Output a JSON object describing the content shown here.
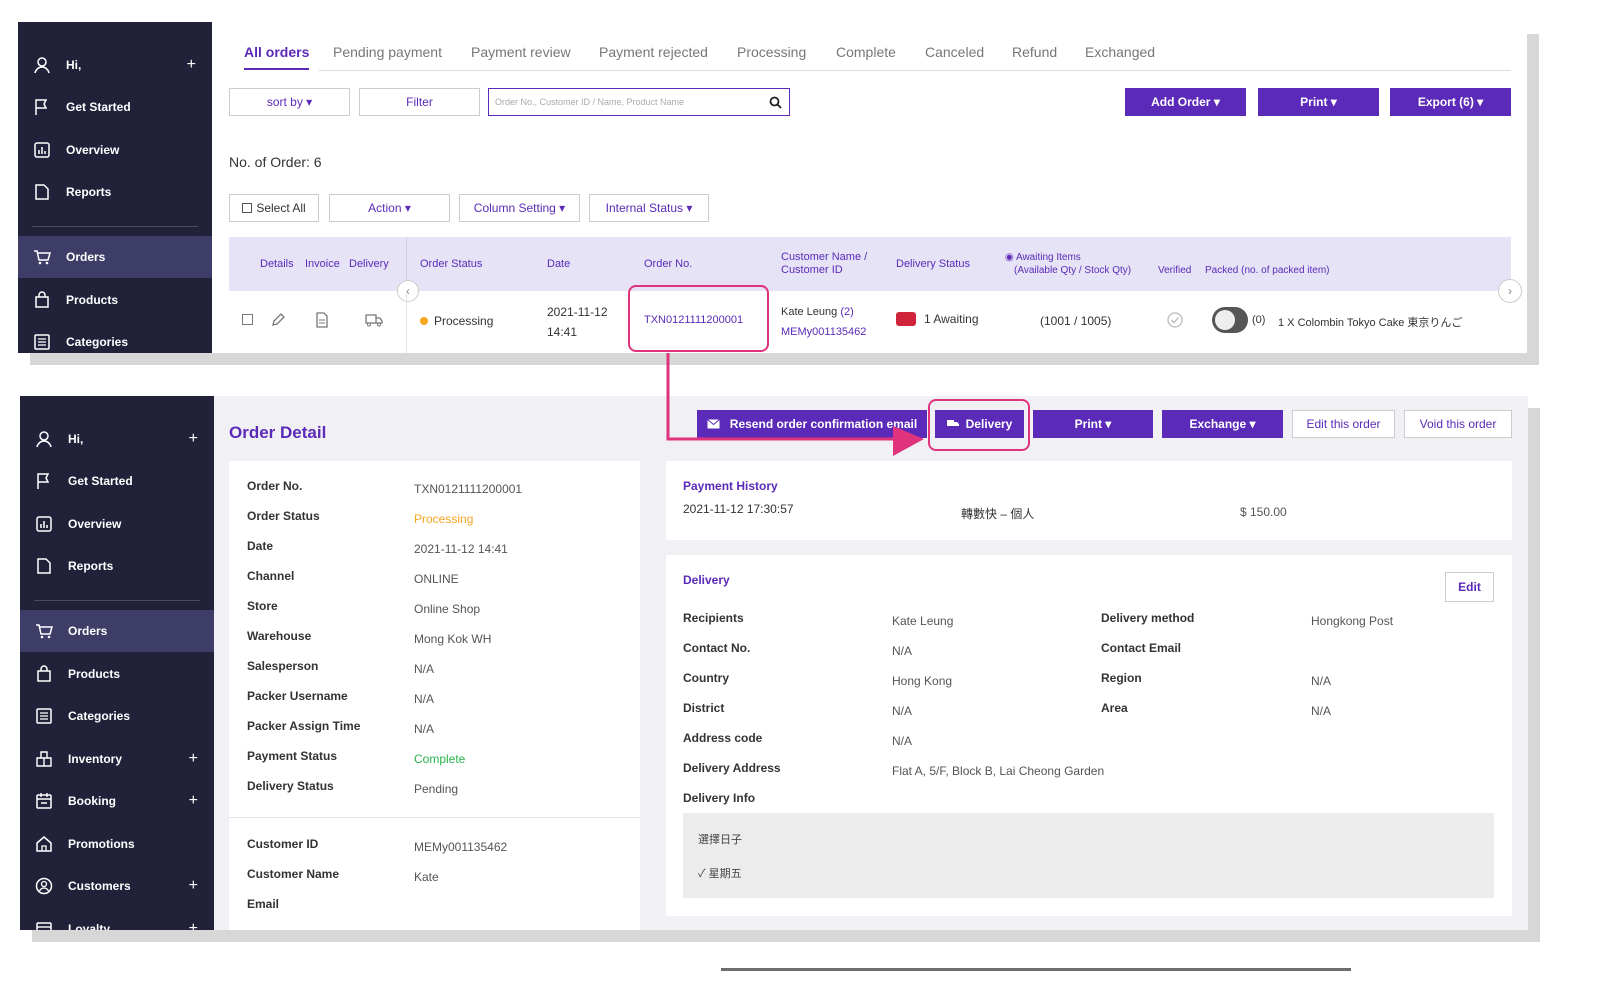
{
  "sidebar": {
    "greeting": "Hi,",
    "items": [
      {
        "label": "Get Started",
        "icon": "flag-icon"
      },
      {
        "label": "Overview",
        "icon": "chart-icon"
      },
      {
        "label": "Reports",
        "icon": "document-icon"
      },
      {
        "label": "Orders",
        "icon": "cart-icon"
      },
      {
        "label": "Products",
        "icon": "bag-icon"
      },
      {
        "label": "Categories",
        "icon": "list-icon"
      },
      {
        "label": "Inventory",
        "icon": "boxes-icon"
      },
      {
        "label": "Booking",
        "icon": "calendar-icon"
      },
      {
        "label": "Promotions",
        "icon": "home-icon"
      },
      {
        "label": "Customers",
        "icon": "user-circle-icon"
      },
      {
        "label": "Loyalty",
        "icon": "calendar-icon"
      }
    ]
  },
  "orders_list": {
    "tabs": [
      "All orders",
      "Pending payment",
      "Payment review",
      "Payment rejected",
      "Processing",
      "Complete",
      "Canceled",
      "Refund",
      "Exchanged"
    ],
    "sort_label": "sort by ▾",
    "filter_label": "Filter",
    "search_placeholder": "Order No., Customer ID / Name, Product Name",
    "add_order_label": "Add Order ▾",
    "print_label": "Print ▾",
    "export_label": "Export (6) ▾",
    "count_label": "No. of Order: 6",
    "select_all_label": "Select All",
    "action_label": "Action ▾",
    "column_setting_label": "Column Setting ▾",
    "internal_status_label": "Internal Status ▾",
    "headers": {
      "details": "Details",
      "invoice": "Invoice",
      "delivery": "Delivery",
      "order_status": "Order Status",
      "date": "Date",
      "order_no": "Order No.",
      "customer_1": "Customer Name /",
      "customer_2": "Customer ID",
      "delivery_status": "Delivery Status",
      "awaiting_1": "Awaiting Items",
      "awaiting_2": "(Available Qty / Stock Qty)",
      "verified": "Verified",
      "packed": "Packed (no. of packed item)"
    },
    "row": {
      "status": "Processing",
      "date_1": "2021-11-12",
      "date_2": "14:41",
      "order_no": "TXN0121111200001",
      "customer_name": "Kate Leung",
      "customer_count": "(2)",
      "customer_id": "MEMy001135462",
      "delivery_status": "1 Awaiting",
      "awaiting_qty": "(1001 / 1005)",
      "packed_count": "(0)",
      "item": "1 X Colombin Tokyo Cake 東京りんご"
    }
  },
  "order_detail": {
    "title": "Order Detail",
    "resend_label": "Resend order confirmation email",
    "delivery_label": "Delivery",
    "print_label": "Print ▾",
    "exchange_label": "Exchange ▾",
    "edit_order_label": "Edit this order",
    "void_order_label": "Void this order",
    "fields": [
      {
        "label": "Order No.",
        "value": "TXN0121111200001"
      },
      {
        "label": "Order Status",
        "value": "Processing"
      },
      {
        "label": "Date",
        "value": "2021-11-12 14:41"
      },
      {
        "label": "Channel",
        "value": "ONLINE"
      },
      {
        "label": "Store",
        "value": "Online Shop"
      },
      {
        "label": "Warehouse",
        "value": "Mong Kok WH"
      },
      {
        "label": "Salesperson",
        "value": "N/A"
      },
      {
        "label": "Packer Username",
        "value": "N/A"
      },
      {
        "label": "Packer Assign Time",
        "value": "N/A"
      },
      {
        "label": "Payment Status",
        "value": "Complete"
      },
      {
        "label": "Delivery Status",
        "value": "Pending"
      }
    ],
    "customer_fields": [
      {
        "label": "Customer ID",
        "value": "MEMy001135462"
      },
      {
        "label": "Customer Name",
        "value": "Kate"
      },
      {
        "label": "Email",
        "value": ""
      }
    ],
    "payment_history": {
      "title": "Payment History",
      "datetime": "2021-11-12 17:30:57",
      "method": "轉數快 – 個人",
      "amount": "$ 150.00"
    },
    "delivery": {
      "title": "Delivery",
      "edit_label": "Edit",
      "left": [
        {
          "label": "Recipients",
          "value": "Kate Leung"
        },
        {
          "label": "Contact No.",
          "value": "N/A"
        },
        {
          "label": "Country",
          "value": "Hong Kong"
        },
        {
          "label": "District",
          "value": "N/A"
        },
        {
          "label": "Address code",
          "value": "N/A"
        },
        {
          "label": "Delivery Address",
          "value": "Flat A, 5/F, Block B, Lai Cheong Garden"
        },
        {
          "label": "Delivery Info",
          "value": ""
        }
      ],
      "right": [
        {
          "label": "Delivery method",
          "value": "Hongkong Post"
        },
        {
          "label": "Contact Email",
          "value": ""
        },
        {
          "label": "Region",
          "value": "N/A"
        },
        {
          "label": "Area",
          "value": "N/A"
        }
      ],
      "info_title": "選擇日子",
      "info_value": "✓ 星期五"
    }
  },
  "colors": {
    "accent": "#5b2ab8",
    "sidebar": "#21213a",
    "highlight": "#e0337d",
    "processing": "#f5a623",
    "complete": "#2bb24c"
  }
}
